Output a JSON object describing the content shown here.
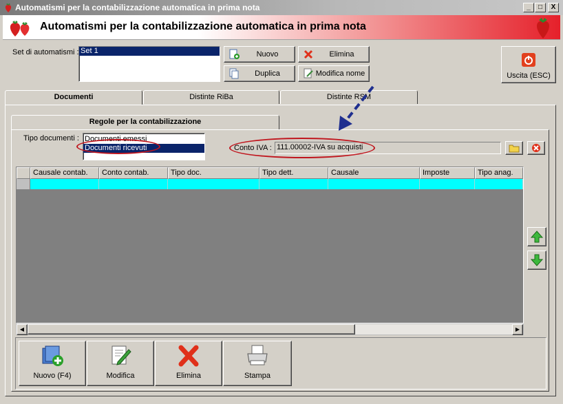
{
  "window": {
    "title": "Automatismi per la contabilizzazione automatica in prima nota",
    "controls": {
      "minimize": "_",
      "maximize": "□",
      "close": "X"
    }
  },
  "header": {
    "title": "Automatismi per la contabilizzazione automatica in prima nota"
  },
  "sets": {
    "label": "Set di automatismi :",
    "items": [
      "Set 1"
    ],
    "selected": "Set 1"
  },
  "buttons": {
    "nuovo": "Nuovo",
    "elimina": "Elimina",
    "duplica": "Duplica",
    "modifica_nome": "Modifica nome",
    "uscita": "Uscita (ESC)"
  },
  "tabs": [
    "Documenti",
    "Distinte RiBa",
    "Distinte RSM"
  ],
  "subtab": "Regole per la contabilizzazione",
  "tipo_documenti": {
    "label": "Tipo documenti :",
    "items": [
      "Documenti emessi",
      "Documenti ricevuti"
    ],
    "selected": "Documenti ricevuti"
  },
  "conto_iva": {
    "label": "Conto IVA :",
    "value": "111.00002-IVA su acquisti"
  },
  "grid": {
    "columns": [
      "Causale contab.",
      "Conto contab.",
      "Tipo doc.",
      "Tipo dett.",
      "Causale",
      "Imposte",
      "Tipo anag."
    ]
  },
  "bottom_buttons": {
    "nuovo": "Nuovo (F4)",
    "modifica": "Modifica",
    "elimina": "Elimina",
    "stampa": "Stampa"
  },
  "colors": {
    "selection": "#0a246a",
    "grid_row": "#00ffff",
    "annotation": "#c0161e",
    "arrow": "#1f2f8f"
  }
}
